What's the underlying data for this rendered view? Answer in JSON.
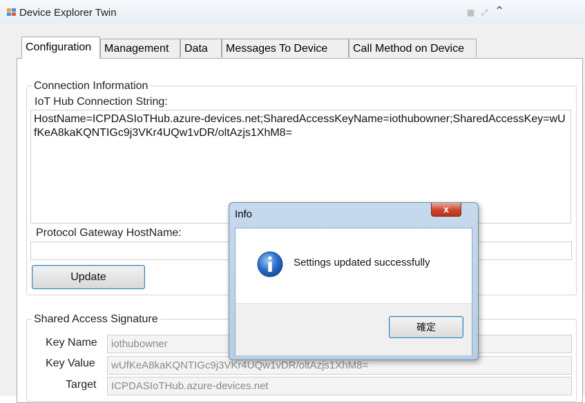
{
  "window": {
    "title": "Device Explorer Twin"
  },
  "tabs": [
    {
      "label": "Configuration"
    },
    {
      "label": "Management"
    },
    {
      "label": "Data"
    },
    {
      "label": "Messages To Device"
    },
    {
      "label": "Call Method on Device"
    }
  ],
  "connection": {
    "group_label": "Connection Information",
    "connection_string_label": "IoT Hub Connection String:",
    "connection_string_value": "HostName=ICPDASIoTHub.azure-devices.net;SharedAccessKeyName=iothubowner;SharedAccessKey=wUfKeA8kaKQNTIGc9j3VKr4UQw1vDR/oltAzjs1XhM8=",
    "gateway_label": "Protocol Gateway HostName:",
    "gateway_value": "",
    "update_label": "Update"
  },
  "sas": {
    "group_label": "Shared Access Signature",
    "key_name_label": "Key Name",
    "key_name_value": "iothubowner",
    "key_value_label": "Key Value",
    "key_value_value": "wUfKeA8kaKQNTIGc9j3VKr4UQw1vDR/oltAzjs1XhM8=",
    "target_label": "Target",
    "target_value": "ICPDASIoTHub.azure-devices.net"
  },
  "dialog": {
    "title": "Info",
    "close_glyph": "x",
    "message": "Settings updated successfully",
    "ok_label": "確定",
    "icon": "info-icon"
  },
  "colors": {
    "accent_border": "#3c7fb1",
    "dialog_frame": "#c7d9ec",
    "close_button": "#c9452c",
    "info_icon": "#2a6fc9"
  }
}
